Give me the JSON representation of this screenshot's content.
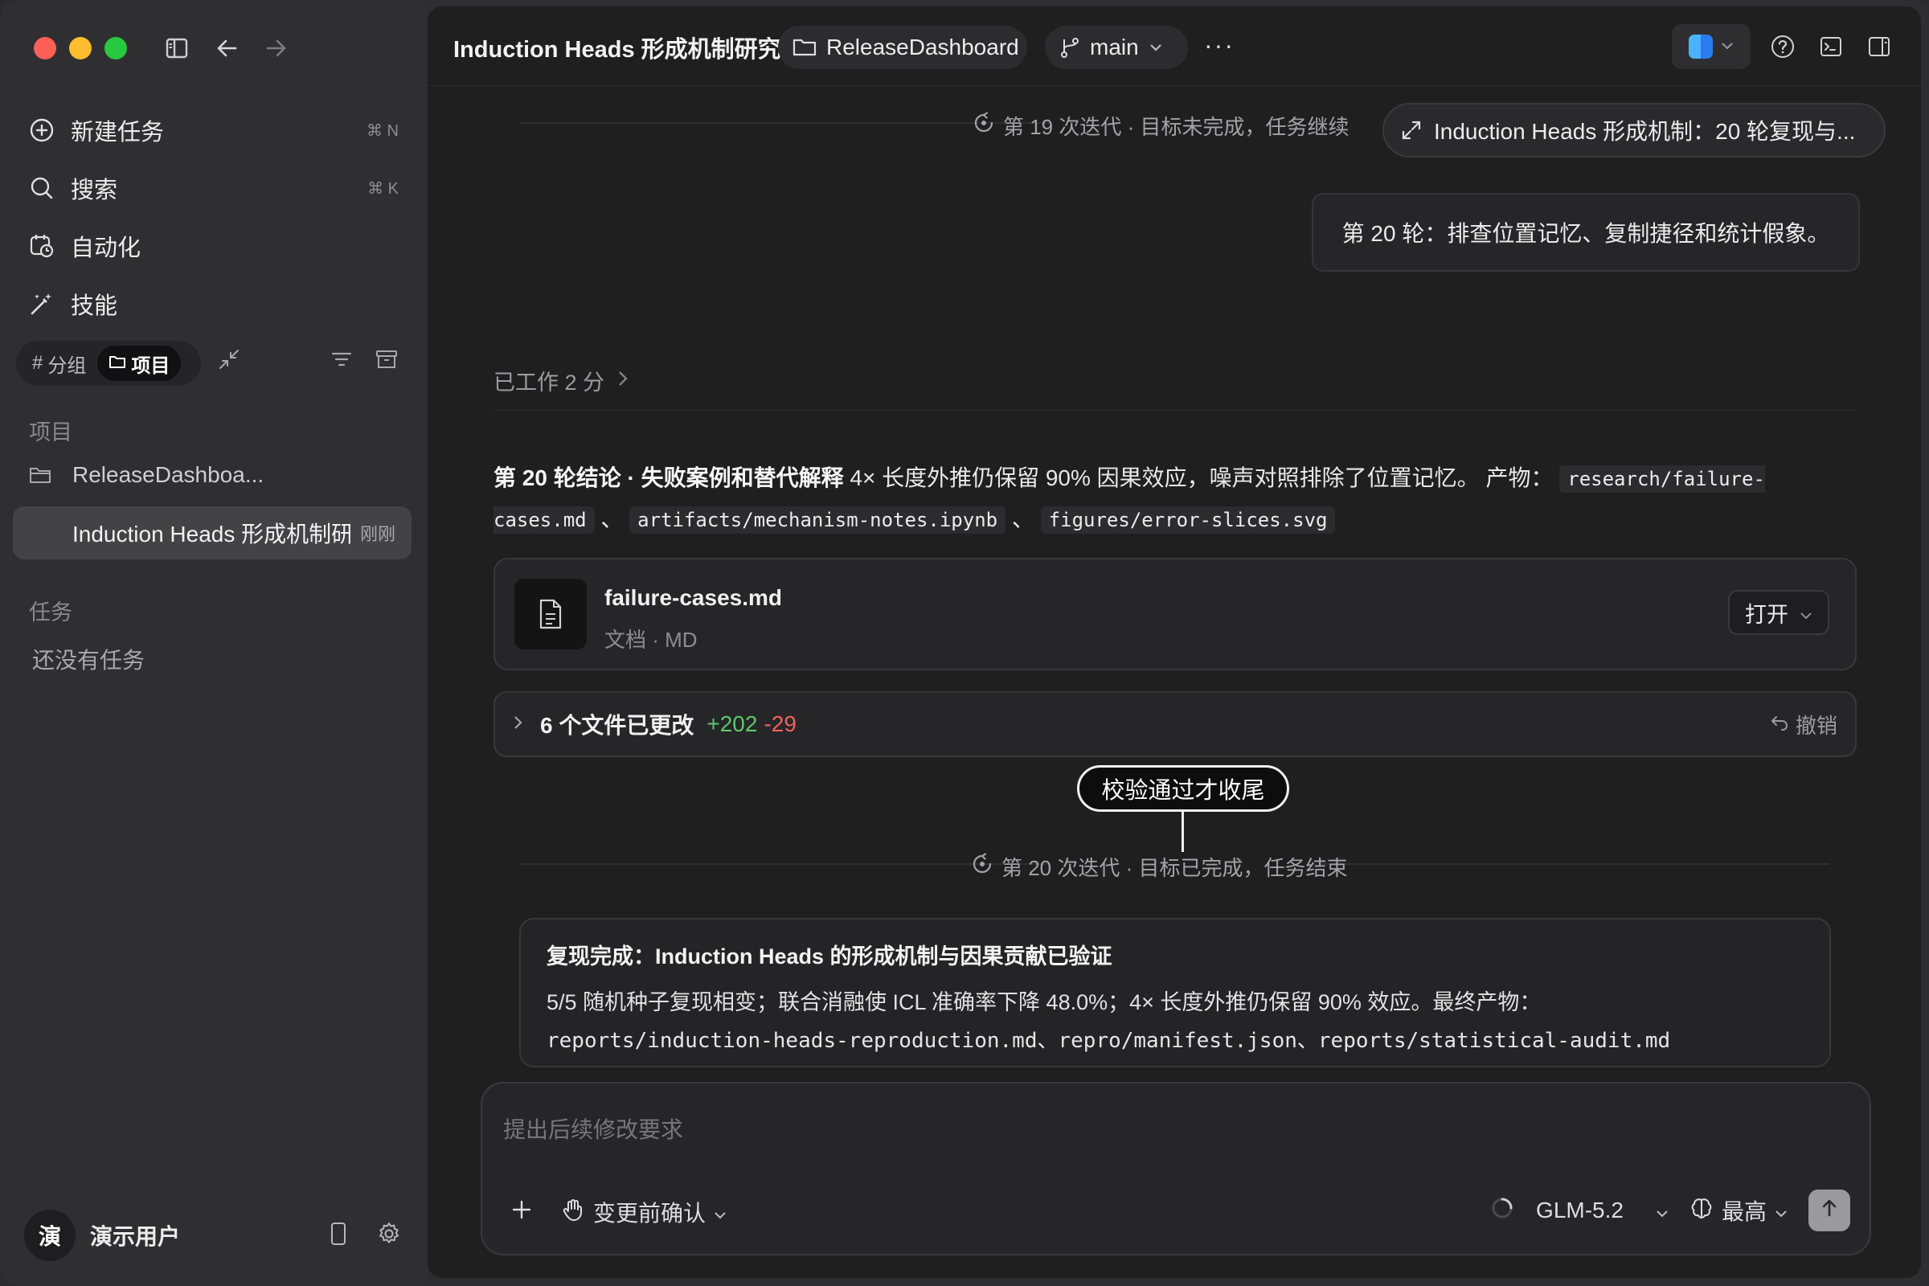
{
  "sidebar": {
    "nav": [
      {
        "label": "新建任务",
        "shortcut": "⌘ N",
        "icon": "plus-circle-icon"
      },
      {
        "label": "搜索",
        "shortcut": "⌘ K",
        "icon": "search-icon"
      },
      {
        "label": "自动化",
        "shortcut": "",
        "icon": "clock-calendar-icon"
      },
      {
        "label": "技能",
        "shortcut": "",
        "icon": "magic-wand-icon"
      }
    ],
    "segment": {
      "group": "分组",
      "project": "项目"
    },
    "projects_title": "项目",
    "projects": [
      {
        "label": "ReleaseDashboa...",
        "time": ""
      },
      {
        "label": "Induction Heads 形成机制研",
        "time": "刚刚"
      }
    ],
    "tasks_title": "任务",
    "tasks_empty": "还没有任务",
    "user": {
      "avatar": "演",
      "name": "演示用户"
    }
  },
  "header": {
    "title": "Induction Heads 形成机制研究",
    "folder": "ReleaseDashboard",
    "branch": "main",
    "more": "···"
  },
  "chat": {
    "iteration_19": "第 19 次迭代 · 目标未完成，任务继续",
    "floating_pill": "Induction Heads 形成机制：20 轮复现与...",
    "user_message": "第 20 轮：排查位置记忆、复制捷径和统计假象。",
    "worked": "已工作 2 分",
    "conclusion": {
      "bold": "第 20 轮结论 · 失败案例和替代解释",
      "text": " 4× 长度外推仍保留 90% 因果效应，噪声对照排除了位置记忆。 产物：",
      "code1": "research/failure-cases.md",
      "sep": "、",
      "code2": "artifacts/mechanism-notes.ipynb",
      "code3": "figures/error-slices.svg"
    },
    "file_card": {
      "name": "failure-cases.md",
      "type": "文档 · MD",
      "open": "打开"
    },
    "changes": {
      "label": "6 个文件已更改",
      "added": "+202",
      "removed": "-29",
      "undo": "撤销"
    },
    "callout": "校验通过才收尾",
    "iteration_20": "第 20 次迭代 · 目标已完成，任务结束",
    "summary": {
      "title": "复现完成：Induction Heads 的形成机制与因果贡献已验证",
      "body": "5/5 随机种子复现相变；联合消融使 ICL 准确率下降 48.0%；4× 长度外推仍保留 90% 效应。最终产物：",
      "paths": "reports/induction-heads-reproduction.md、repro/manifest.json、reports/statistical-audit.md"
    }
  },
  "composer": {
    "placeholder": "提出后续修改要求",
    "confirm": "变更前确认",
    "model": "GLM-5.2",
    "effort": "最高"
  },
  "colors": {
    "added": "#5cc86a",
    "removed": "#f0635c",
    "accent": "#28c840"
  }
}
